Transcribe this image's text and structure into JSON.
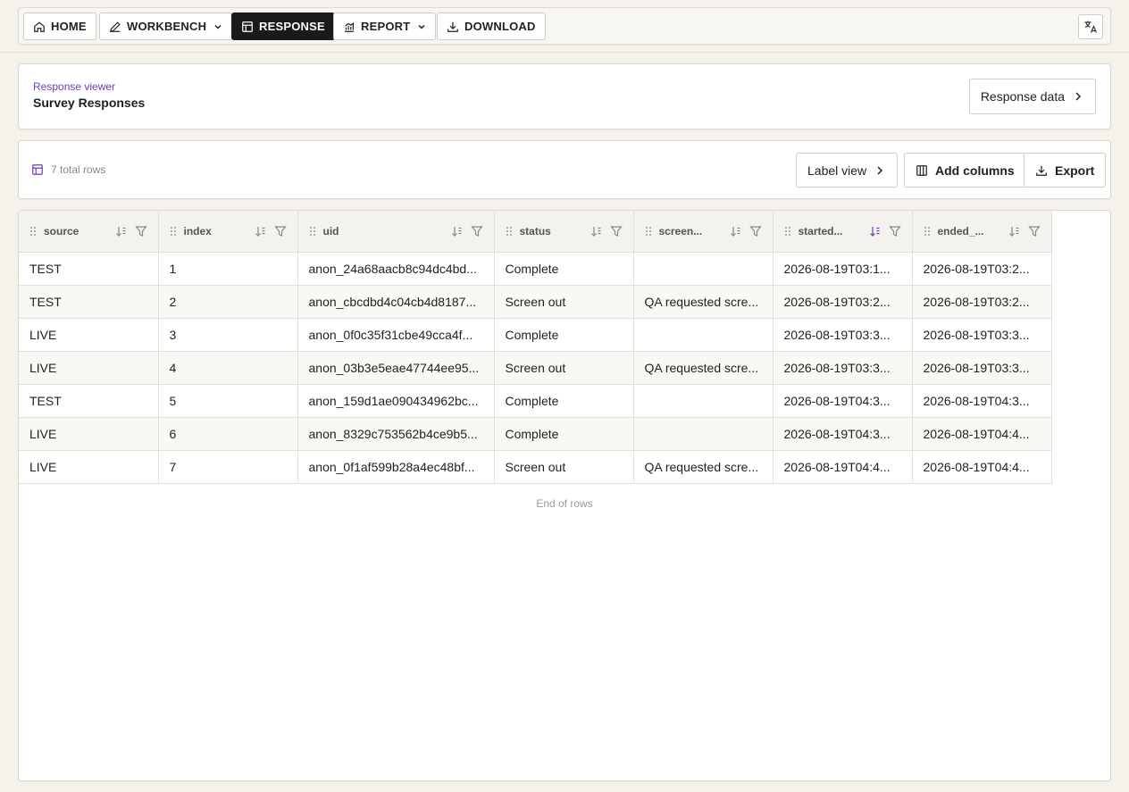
{
  "nav": {
    "home": "HOME",
    "workbench": "WORKBENCH",
    "response": "RESPONSE",
    "report": "REPORT",
    "download": "DOWNLOAD"
  },
  "header": {
    "eyebrow": "Response viewer",
    "title": "Survey Responses",
    "response_data_button": "Response data"
  },
  "toolbar": {
    "row_count": "7 total rows",
    "label_view": "Label view",
    "add_columns": "Add columns",
    "export": "Export"
  },
  "table": {
    "columns": [
      "source",
      "index",
      "uid",
      "status",
      "screen...",
      "started...",
      "ended_..."
    ],
    "rows": [
      [
        "TEST",
        "1",
        "anon_24a68aacb8c94dc4bd...",
        "Complete",
        "",
        "2026-08-19T03:1...",
        "2026-08-19T03:2..."
      ],
      [
        "TEST",
        "2",
        "anon_cbcdbd4c04cb4d8187...",
        "Screen out",
        "QA requested scre...",
        "2026-08-19T03:2...",
        "2026-08-19T03:2..."
      ],
      [
        "LIVE",
        "3",
        "anon_0f0c35f31cbe49cca4f...",
        "Complete",
        "",
        "2026-08-19T03:3...",
        "2026-08-19T03:3..."
      ],
      [
        "LIVE",
        "4",
        "anon_03b3e5eae47744ee95...",
        "Screen out",
        "QA requested scre...",
        "2026-08-19T03:3...",
        "2026-08-19T03:3..."
      ],
      [
        "TEST",
        "5",
        "anon_159d1ae090434962bc...",
        "Complete",
        "",
        "2026-08-19T04:3...",
        "2026-08-19T04:3..."
      ],
      [
        "LIVE",
        "6",
        "anon_8329c753562b4ce9b5...",
        "Complete",
        "",
        "2026-08-19T04:3...",
        "2026-08-19T04:4..."
      ],
      [
        "LIVE",
        "7",
        "anon_0f1af599b28a4ec48bf...",
        "Screen out",
        "QA requested scre...",
        "2026-08-19T04:4...",
        "2026-08-19T04:4..."
      ]
    ],
    "active_sort_column": "started...",
    "end_text": "End of rows"
  },
  "colors": {
    "accent": "#6d3fc0",
    "active_nav": "#1a1a1a"
  }
}
